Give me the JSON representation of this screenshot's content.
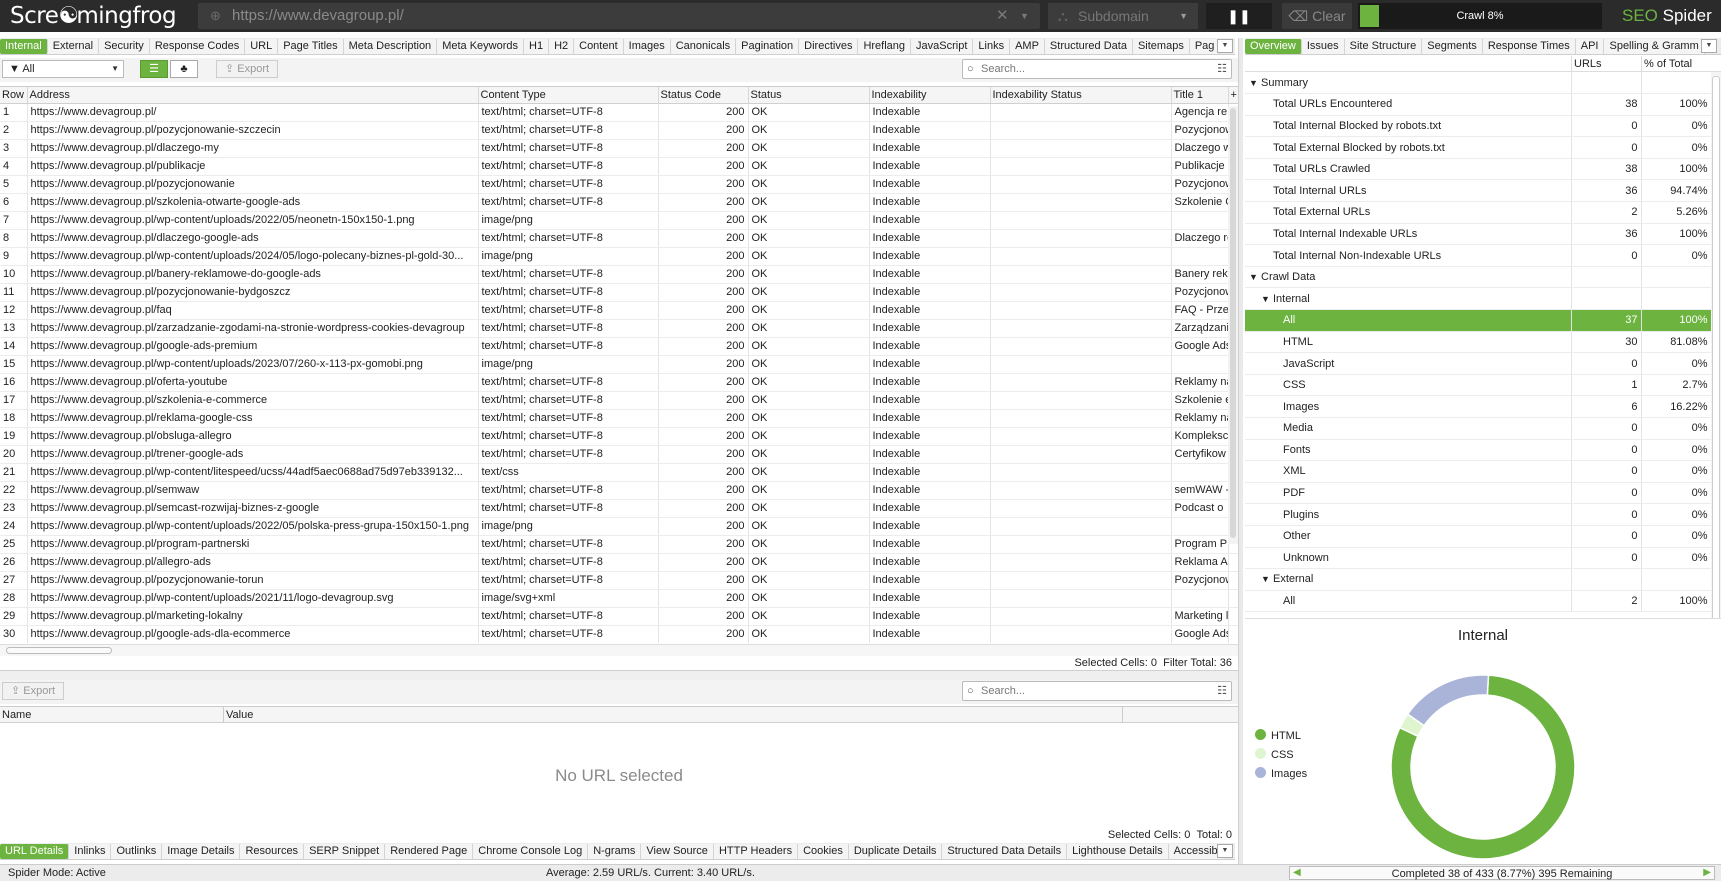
{
  "app": {
    "logo_pre": "Scre",
    "logo_post": "mingfrog",
    "url_value": "https://www.devagroup.pl/",
    "subdomain": "Subdomain",
    "pause": "Pause",
    "clear": "Clear",
    "crawl_label": "Crawl 8%",
    "crawl_progress": 0.08,
    "brand_seo": "SEO",
    "brand_spider": "Spider",
    "accent": "#6cb33f"
  },
  "main_tabs": [
    "Internal",
    "External",
    "Security",
    "Response Codes",
    "URL",
    "Page Titles",
    "Meta Description",
    "Meta Keywords",
    "H1",
    "H2",
    "Content",
    "Images",
    "Canonicals",
    "Pagination",
    "Directives",
    "Hreflang",
    "JavaScript",
    "Links",
    "AMP",
    "Structured Data",
    "Sitemaps",
    "Pag"
  ],
  "right_tabs": [
    "Overview",
    "Issues",
    "Site Structure",
    "Segments",
    "Response Times",
    "API",
    "Spelling & Gramm"
  ],
  "bottom_tabs": [
    "URL Details",
    "Inlinks",
    "Outlinks",
    "Image Details",
    "Resources",
    "SERP Snippet",
    "Rendered Page",
    "Chrome Console Log",
    "N-grams",
    "View Source",
    "HTTP Headers",
    "Cookies",
    "Duplicate Details",
    "Structured Data Details",
    "Lighthouse Details",
    "Accessibi"
  ],
  "toolbar": {
    "filter": "All",
    "export": "Export",
    "search_placeholder": "Search..."
  },
  "grid": {
    "columns": [
      "Row",
      "Address",
      "Content Type",
      "Status Code",
      "Status",
      "Indexability",
      "Indexability Status",
      "Title 1"
    ],
    "rows": [
      [
        "1",
        "https://www.devagroup.pl/",
        "text/html; charset=UTF-8",
        "200",
        "OK",
        "Indexable",
        "",
        "Agencja re"
      ],
      [
        "2",
        "https://www.devagroup.pl/pozycjonowanie-szczecin",
        "text/html; charset=UTF-8",
        "200",
        "OK",
        "Indexable",
        "",
        "Pozycjonow"
      ],
      [
        "3",
        "https://www.devagroup.pl/dlaczego-my",
        "text/html; charset=UTF-8",
        "200",
        "OK",
        "Indexable",
        "",
        "Dlaczego w"
      ],
      [
        "4",
        "https://www.devagroup.pl/publikacje",
        "text/html; charset=UTF-8",
        "200",
        "OK",
        "Indexable",
        "",
        "Publikacje"
      ],
      [
        "5",
        "https://www.devagroup.pl/pozycjonowanie",
        "text/html; charset=UTF-8",
        "200",
        "OK",
        "Indexable",
        "",
        "Pozycjonow"
      ],
      [
        "6",
        "https://www.devagroup.pl/szkolenia-otwarte-google-ads",
        "text/html; charset=UTF-8",
        "200",
        "OK",
        "Indexable",
        "",
        "Szkolenie G"
      ],
      [
        "7",
        "https://www.devagroup.pl/wp-content/uploads/2022/05/neonetn-150x150-1.png",
        "image/png",
        "200",
        "OK",
        "Indexable",
        "",
        ""
      ],
      [
        "8",
        "https://www.devagroup.pl/dlaczego-google-ads",
        "text/html; charset=UTF-8",
        "200",
        "OK",
        "Indexable",
        "",
        "Dlaczego re"
      ],
      [
        "9",
        "https://www.devagroup.pl/wp-content/uploads/2024/05/logo-polecany-biznes-pl-gold-30...",
        "image/png",
        "200",
        "OK",
        "Indexable",
        "",
        ""
      ],
      [
        "10",
        "https://www.devagroup.pl/banery-reklamowe-do-google-ads",
        "text/html; charset=UTF-8",
        "200",
        "OK",
        "Indexable",
        "",
        "Banery rekl"
      ],
      [
        "11",
        "https://www.devagroup.pl/pozycjonowanie-bydgoszcz",
        "text/html; charset=UTF-8",
        "200",
        "OK",
        "Indexable",
        "",
        "Pozycjonow"
      ],
      [
        "12",
        "https://www.devagroup.pl/faq",
        "text/html; charset=UTF-8",
        "200",
        "OK",
        "Indexable",
        "",
        "FAQ - Przed"
      ],
      [
        "13",
        "https://www.devagroup.pl/zarzadzanie-zgodami-na-stronie-wordpress-cookies-devagroup",
        "text/html; charset=UTF-8",
        "200",
        "OK",
        "Indexable",
        "",
        "Zarządzani"
      ],
      [
        "14",
        "https://www.devagroup.pl/google-ads-premium",
        "text/html; charset=UTF-8",
        "200",
        "OK",
        "Indexable",
        "",
        "Google Ads"
      ],
      [
        "15",
        "https://www.devagroup.pl/wp-content/uploads/2023/07/260-x-113-px-gomobi.png",
        "image/png",
        "200",
        "OK",
        "Indexable",
        "",
        ""
      ],
      [
        "16",
        "https://www.devagroup.pl/oferta-youtube",
        "text/html; charset=UTF-8",
        "200",
        "OK",
        "Indexable",
        "",
        "Reklamy na"
      ],
      [
        "17",
        "https://www.devagroup.pl/szkolenia-e-commerce",
        "text/html; charset=UTF-8",
        "200",
        "OK",
        "Indexable",
        "",
        "Szkolenie e"
      ],
      [
        "18",
        "https://www.devagroup.pl/reklama-google-css",
        "text/html; charset=UTF-8",
        "200",
        "OK",
        "Indexable",
        "",
        "Reklamy na"
      ],
      [
        "19",
        "https://www.devagroup.pl/obsluga-allegro",
        "text/html; charset=UTF-8",
        "200",
        "OK",
        "Indexable",
        "",
        "Kompleksc"
      ],
      [
        "20",
        "https://www.devagroup.pl/trener-google-ads",
        "text/html; charset=UTF-8",
        "200",
        "OK",
        "Indexable",
        "",
        "Certyfikow"
      ],
      [
        "21",
        "https://www.devagroup.pl/wp-content/litespeed/ucss/44adf5aec0688ad75d97eb339132...",
        "text/css",
        "200",
        "OK",
        "Indexable",
        "",
        ""
      ],
      [
        "22",
        "https://www.devagroup.pl/semwaw",
        "text/html; charset=UTF-8",
        "200",
        "OK",
        "Indexable",
        "",
        "semWAW -"
      ],
      [
        "23",
        "https://www.devagroup.pl/semcast-rozwijaj-biznes-z-google",
        "text/html; charset=UTF-8",
        "200",
        "OK",
        "Indexable",
        "",
        "Podcast o"
      ],
      [
        "24",
        "https://www.devagroup.pl/wp-content/uploads/2022/05/polska-press-grupa-150x150-1.png",
        "image/png",
        "200",
        "OK",
        "Indexable",
        "",
        ""
      ],
      [
        "25",
        "https://www.devagroup.pl/program-partnerski",
        "text/html; charset=UTF-8",
        "200",
        "OK",
        "Indexable",
        "",
        "Program P"
      ],
      [
        "26",
        "https://www.devagroup.pl/allegro-ads",
        "text/html; charset=UTF-8",
        "200",
        "OK",
        "Indexable",
        "",
        "Reklama A"
      ],
      [
        "27",
        "https://www.devagroup.pl/pozycjonowanie-torun",
        "text/html; charset=UTF-8",
        "200",
        "OK",
        "Indexable",
        "",
        "Pozycjonow"
      ],
      [
        "28",
        "https://www.devagroup.pl/wp-content/uploads/2021/11/logo-devagroup.svg",
        "image/svg+xml",
        "200",
        "OK",
        "Indexable",
        "",
        ""
      ],
      [
        "29",
        "https://www.devagroup.pl/marketing-lokalny",
        "text/html; charset=UTF-8",
        "200",
        "OK",
        "Indexable",
        "",
        "Marketing l"
      ],
      [
        "30",
        "https://www.devagroup.pl/google-ads-dla-ecommerce",
        "text/html; charset=UTF-8",
        "200",
        "OK",
        "Indexable",
        "",
        "Google Ads"
      ]
    ],
    "footer_selected": "Selected Cells:  0",
    "footer_total": "Filter Total:  36"
  },
  "details": {
    "export": "Export",
    "search_placeholder": "Search...",
    "col_name": "Name",
    "col_value": "Value",
    "empty": "No URL selected",
    "footer_selected": "Selected Cells:  0",
    "footer_total": "Total:  0"
  },
  "overview": {
    "col_urls": "URLs",
    "col_pct": "% of Total",
    "rows": [
      {
        "label": "Summary",
        "urls": "",
        "pct": "",
        "level": 0,
        "toggle": "▼",
        "sel": false
      },
      {
        "label": "Total URLs Encountered",
        "urls": "38",
        "pct": "100%",
        "level": 1,
        "toggle": "",
        "sel": false
      },
      {
        "label": "Total Internal Blocked by robots.txt",
        "urls": "0",
        "pct": "0%",
        "level": 1,
        "toggle": "",
        "sel": false
      },
      {
        "label": "Total External Blocked by robots.txt",
        "urls": "0",
        "pct": "0%",
        "level": 1,
        "toggle": "",
        "sel": false
      },
      {
        "label": "Total URLs Crawled",
        "urls": "38",
        "pct": "100%",
        "level": 1,
        "toggle": "",
        "sel": false
      },
      {
        "label": "Total Internal URLs",
        "urls": "36",
        "pct": "94.74%",
        "level": 1,
        "toggle": "",
        "sel": false
      },
      {
        "label": "Total External URLs",
        "urls": "2",
        "pct": "5.26%",
        "level": 1,
        "toggle": "",
        "sel": false
      },
      {
        "label": "Total Internal Indexable URLs",
        "urls": "36",
        "pct": "100%",
        "level": 1,
        "toggle": "",
        "sel": false
      },
      {
        "label": "Total Internal Non-Indexable URLs",
        "urls": "0",
        "pct": "0%",
        "level": 1,
        "toggle": "",
        "sel": false
      },
      {
        "label": "Crawl Data",
        "urls": "",
        "pct": "",
        "level": 0,
        "toggle": "▼",
        "sel": false
      },
      {
        "label": "Internal",
        "urls": "",
        "pct": "",
        "level": 1,
        "toggle": "▼",
        "sel": false
      },
      {
        "label": "All",
        "urls": "37",
        "pct": "100%",
        "level": 2,
        "toggle": "",
        "sel": true
      },
      {
        "label": "HTML",
        "urls": "30",
        "pct": "81.08%",
        "level": 2,
        "toggle": "",
        "sel": false
      },
      {
        "label": "JavaScript",
        "urls": "0",
        "pct": "0%",
        "level": 2,
        "toggle": "",
        "sel": false
      },
      {
        "label": "CSS",
        "urls": "1",
        "pct": "2.7%",
        "level": 2,
        "toggle": "",
        "sel": false
      },
      {
        "label": "Images",
        "urls": "6",
        "pct": "16.22%",
        "level": 2,
        "toggle": "",
        "sel": false
      },
      {
        "label": "Media",
        "urls": "0",
        "pct": "0%",
        "level": 2,
        "toggle": "",
        "sel": false
      },
      {
        "label": "Fonts",
        "urls": "0",
        "pct": "0%",
        "level": 2,
        "toggle": "",
        "sel": false
      },
      {
        "label": "XML",
        "urls": "0",
        "pct": "0%",
        "level": 2,
        "toggle": "",
        "sel": false
      },
      {
        "label": "PDF",
        "urls": "0",
        "pct": "0%",
        "level": 2,
        "toggle": "",
        "sel": false
      },
      {
        "label": "Plugins",
        "urls": "0",
        "pct": "0%",
        "level": 2,
        "toggle": "",
        "sel": false
      },
      {
        "label": "Other",
        "urls": "0",
        "pct": "0%",
        "level": 2,
        "toggle": "",
        "sel": false
      },
      {
        "label": "Unknown",
        "urls": "0",
        "pct": "0%",
        "level": 2,
        "toggle": "",
        "sel": false
      },
      {
        "label": "External",
        "urls": "",
        "pct": "",
        "level": 1,
        "toggle": "▼",
        "sel": false
      },
      {
        "label": "All",
        "urls": "2",
        "pct": "100%",
        "level": 2,
        "toggle": "",
        "sel": false
      }
    ]
  },
  "chart_data": {
    "type": "pie",
    "title": "Internal",
    "categories": [
      "HTML",
      "CSS",
      "Images"
    ],
    "values": [
      30,
      1,
      6
    ],
    "colors": [
      "#6cb33f",
      "#dff5cf",
      "#aab4d9"
    ],
    "donut": true,
    "legend": "left"
  },
  "statusbar": {
    "mode": "Spider Mode: Active",
    "speed": "Average: 2.59 URL/s. Current: 3.40 URL/s.",
    "completed": "Completed 38 of 433 (8.77%) 395 Remaining"
  }
}
